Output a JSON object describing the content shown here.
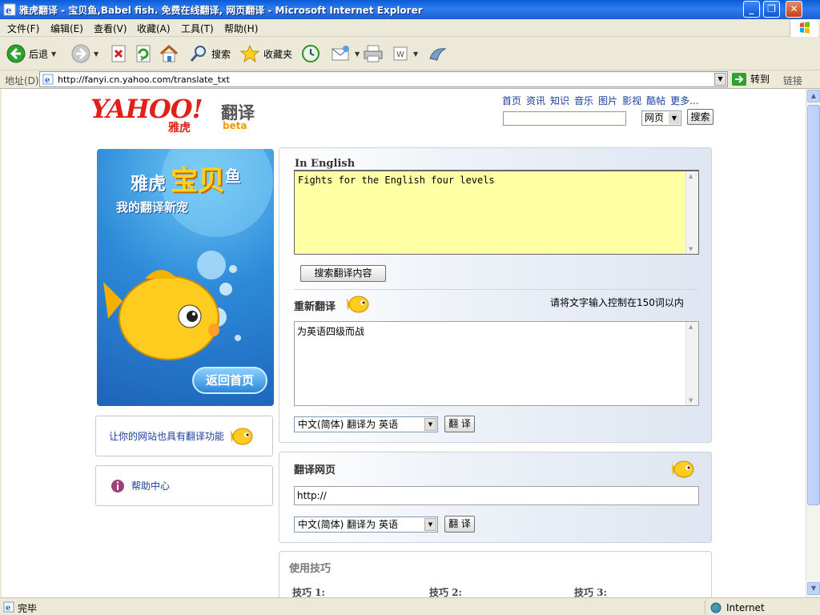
{
  "window": {
    "title": "雅虎翻译 - 宝贝鱼,Babel fish. 免费在线翻译, 网页翻译 - Microsoft Internet Explorer",
    "controls": [
      "_",
      "❐",
      "✕"
    ]
  },
  "menu": [
    "文件(F)",
    "编辑(E)",
    "查看(V)",
    "收藏(A)",
    "工具(T)",
    "帮助(H)"
  ],
  "toolbar": {
    "back": "后退",
    "search": "搜索",
    "favorites": "收藏夹"
  },
  "address": {
    "label": "地址(D)",
    "url": "http://fanyi.cn.yahoo.com/translate_txt",
    "go": "转到",
    "links": "链接"
  },
  "page": {
    "logo": {
      "yahoo": "YAHOO!",
      "yahoo_cn": "雅虎",
      "product": "翻译",
      "beta": "beta"
    },
    "topnav": [
      "首页",
      "资讯",
      "知识",
      "音乐",
      "图片",
      "影视",
      "酷帖",
      "更多..."
    ],
    "search": {
      "scope": "网页",
      "button": "搜索"
    },
    "banner": {
      "line1a": "雅虎",
      "line1b": "宝贝",
      "line1c": "鱼",
      "line2": "我的翻译新宠",
      "home": "返回首页"
    },
    "side": {
      "embed": "让你的网站也具有翻译功能",
      "help": "帮助中心"
    },
    "translate": {
      "source_label": "In English",
      "source_text": "Fights for the English four levels",
      "search_btn": "搜索翻译内容",
      "retranslate": "重新翻译",
      "limit_note": "请将文字输入控制在150词以内",
      "result_text": "为英语四级而战",
      "direction": "中文(简体) 翻译为 英语",
      "translate_btn": "翻 译"
    },
    "webpage": {
      "title": "翻译网页",
      "url_value": "http://",
      "direction": "中文(简体) 翻译为 英语",
      "translate_btn": "翻 译"
    },
    "tips": {
      "title": "使用技巧",
      "items": [
        "技巧 1:",
        "技巧 2:",
        "技巧 3:"
      ]
    }
  },
  "status": {
    "text": "完毕",
    "zone": "Internet"
  }
}
